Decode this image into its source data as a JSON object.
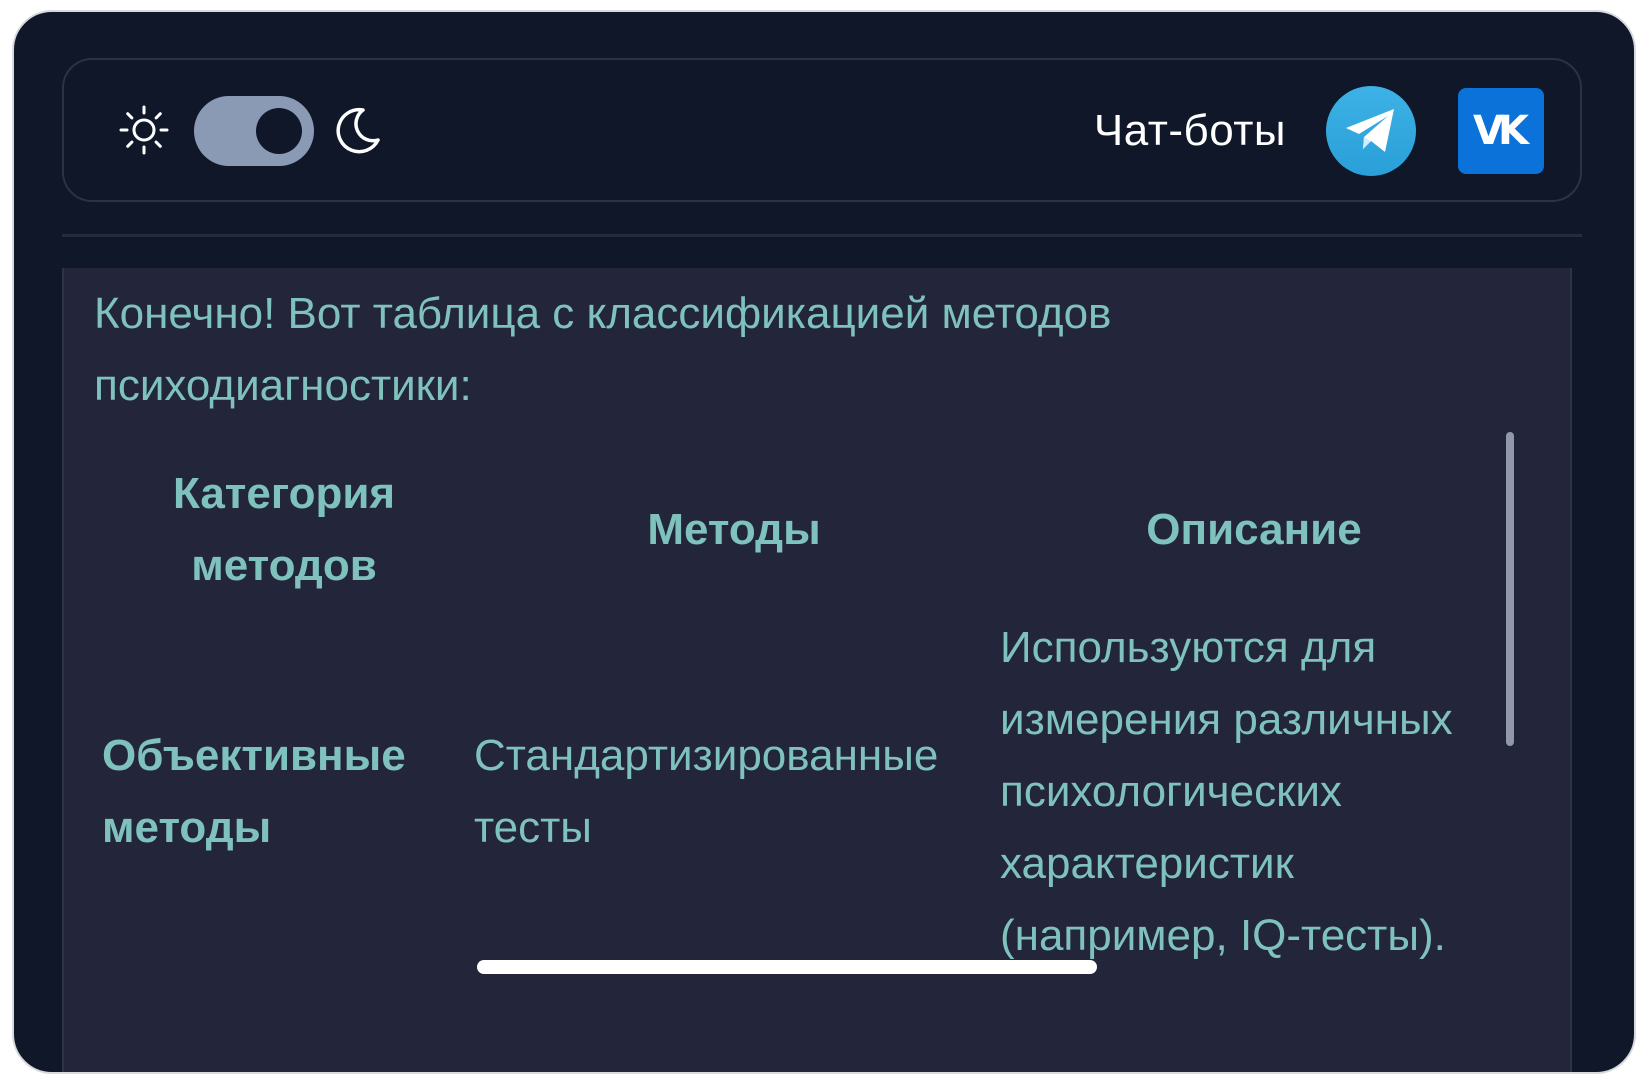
{
  "header": {
    "theme_toggle": {
      "light_icon": "sun-icon",
      "dark_icon": "moon-icon",
      "state": "dark"
    },
    "chatbots_label": "Чат-боты",
    "telegram_icon": "telegram-icon",
    "vk_icon": "vk-icon",
    "vk_text": "VK"
  },
  "message": {
    "intro": "Конечно! Вот таблица с классификацией методов психодиагностики:",
    "table": {
      "headers": [
        "Категория методов",
        "Методы",
        "Описание"
      ],
      "rows": [
        {
          "category": "Объективные методы",
          "methods": "Стандартизированные тесты",
          "description": "Используются для измерения различных психологических характеристик (например, IQ-тесты)."
        }
      ]
    }
  },
  "colors": {
    "background": "#0f1729",
    "message_background": "#23253a",
    "text_teal": "#7fc2bd",
    "telegram_blue": "#2ea6e0",
    "vk_blue": "#0a72d8"
  }
}
